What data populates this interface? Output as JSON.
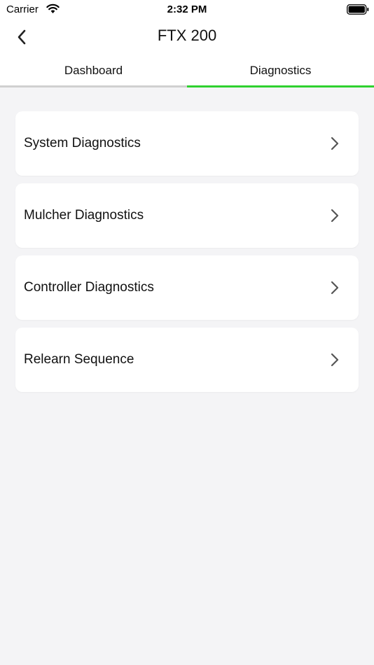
{
  "status_bar": {
    "carrier": "Carrier",
    "time": "2:32 PM",
    "icons": [
      "wifi-icon",
      "battery-icon"
    ]
  },
  "nav": {
    "title": "FTX 200",
    "back_icon": "chevron-left-icon"
  },
  "tabs": [
    {
      "label": "Dashboard",
      "active": false
    },
    {
      "label": "Diagnostics",
      "active": true
    }
  ],
  "accent_color": "#2fd12f",
  "menu": [
    {
      "label": "System Diagnostics",
      "icon": "chevron-right-icon"
    },
    {
      "label": "Mulcher Diagnostics",
      "icon": "chevron-right-icon"
    },
    {
      "label": "Controller Diagnostics",
      "icon": "chevron-right-icon"
    },
    {
      "label": "Relearn Sequence",
      "icon": "chevron-right-icon"
    }
  ]
}
